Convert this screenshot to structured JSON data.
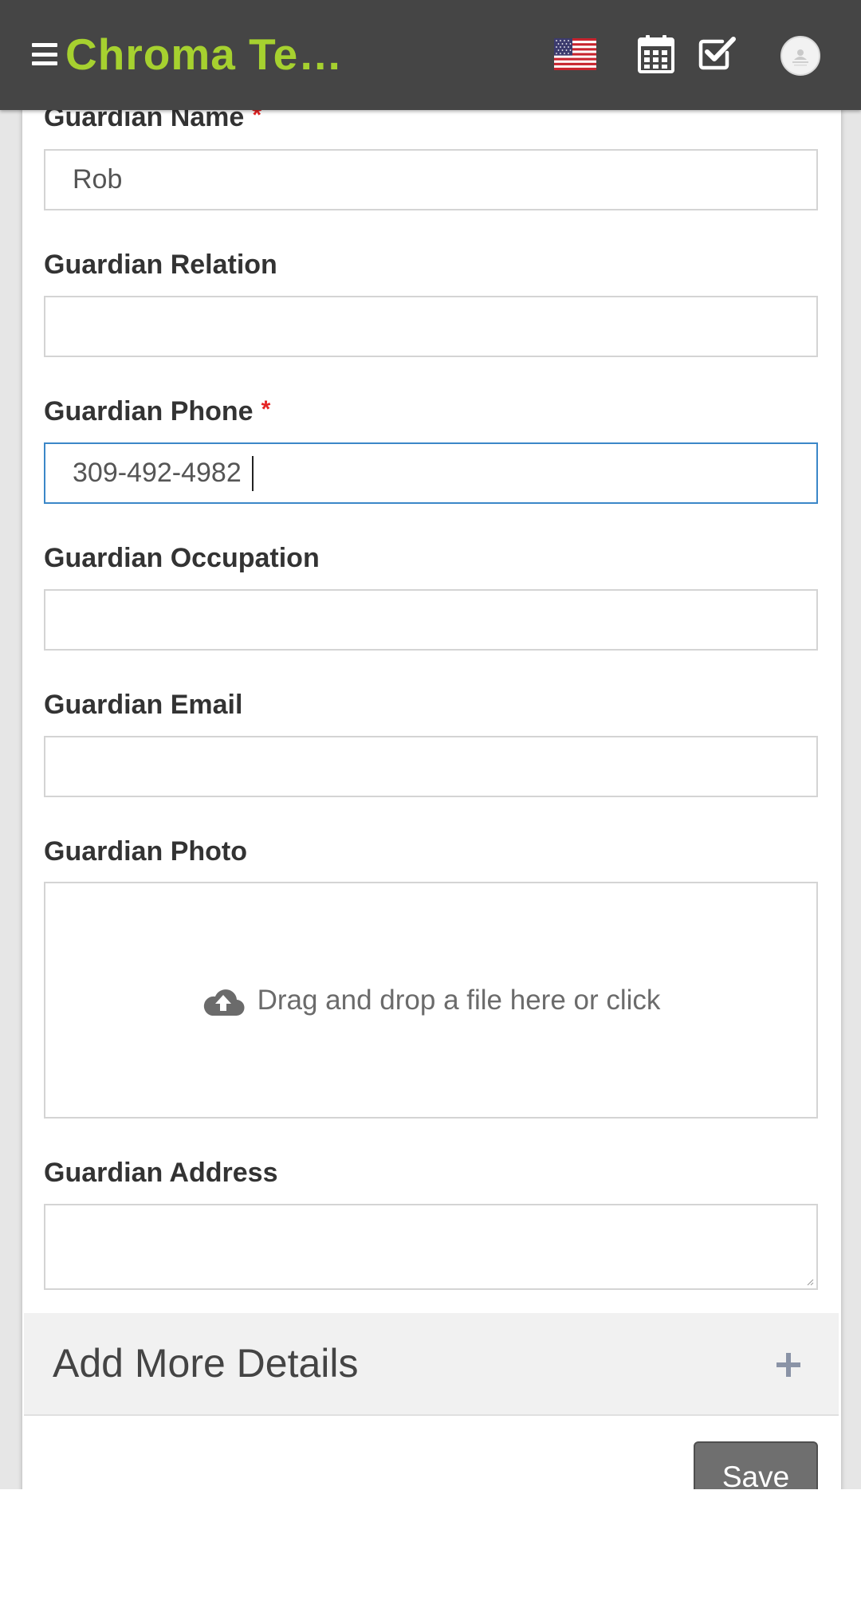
{
  "header": {
    "brand": "Chroma Te…",
    "icons": [
      "menu-icon",
      "us-flag-icon",
      "calendar-icon",
      "checkbox-icon",
      "avatar"
    ]
  },
  "form": {
    "guardian_name": {
      "label": "Guardian Name",
      "required_mark": "*",
      "value": "Rob"
    },
    "guardian_relation": {
      "label": "Guardian Relation",
      "value": ""
    },
    "guardian_phone": {
      "label": "Guardian Phone",
      "required_mark": "*",
      "value": "309-492-4982"
    },
    "guardian_occupation": {
      "label": "Guardian Occupation",
      "value": ""
    },
    "guardian_email": {
      "label": "Guardian Email",
      "value": ""
    },
    "guardian_photo": {
      "label": "Guardian Photo",
      "dropzone_text": "Drag and drop a file here or click",
      "icon": "cloud-upload-icon"
    },
    "guardian_address": {
      "label": "Guardian Address",
      "value": ""
    }
  },
  "more_details": {
    "title": "Add More Details",
    "icon": "plus-icon"
  },
  "actions": {
    "save_label": "Save"
  },
  "colors": {
    "topbar": "#454545",
    "brand": "#a6d12f",
    "required": "#e52323",
    "focus": "#3b87c8",
    "save_button": "#6f6f6f"
  }
}
